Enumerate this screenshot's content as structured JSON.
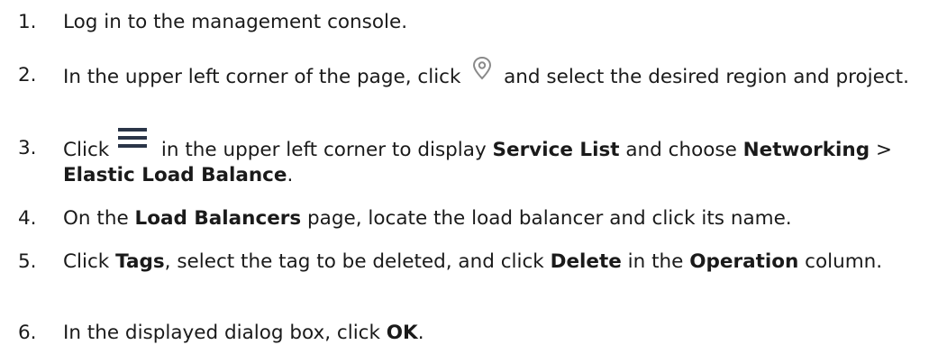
{
  "steps": [
    {
      "number": "1.",
      "text": "Log in to the management console."
    },
    {
      "number": "2.",
      "pre": "In the upper left corner of the page, click ",
      "icon": "location-pin-icon",
      "post": " and select the desired region and project."
    },
    {
      "number": "3.",
      "pre": "Click ",
      "icon": "hamburger-menu-icon",
      "mid": " in the upper left corner to display ",
      "b1": "Service List",
      "mid2": " and choose ",
      "b2": "Networking",
      "mid3": " > ",
      "b3": "Elastic Load Balance",
      "post": "."
    },
    {
      "number": "4.",
      "pre": "On the ",
      "b1": "Load Balancers",
      "post": " page, locate the load balancer and click its name."
    },
    {
      "number": "5.",
      "pre": "Click ",
      "b1": "Tags",
      "mid": ", select the tag to be deleted, and click ",
      "b2": "Delete",
      "mid2": " in the ",
      "b3": "Operation",
      "post": " column."
    },
    {
      "number": "6.",
      "pre": "In the displayed dialog box, click ",
      "b1": "OK",
      "post": "."
    }
  ],
  "colors": {
    "text": "#1a1a1a",
    "pin_icon": "#8a8a8a",
    "menu_icon": "#2a3548"
  }
}
